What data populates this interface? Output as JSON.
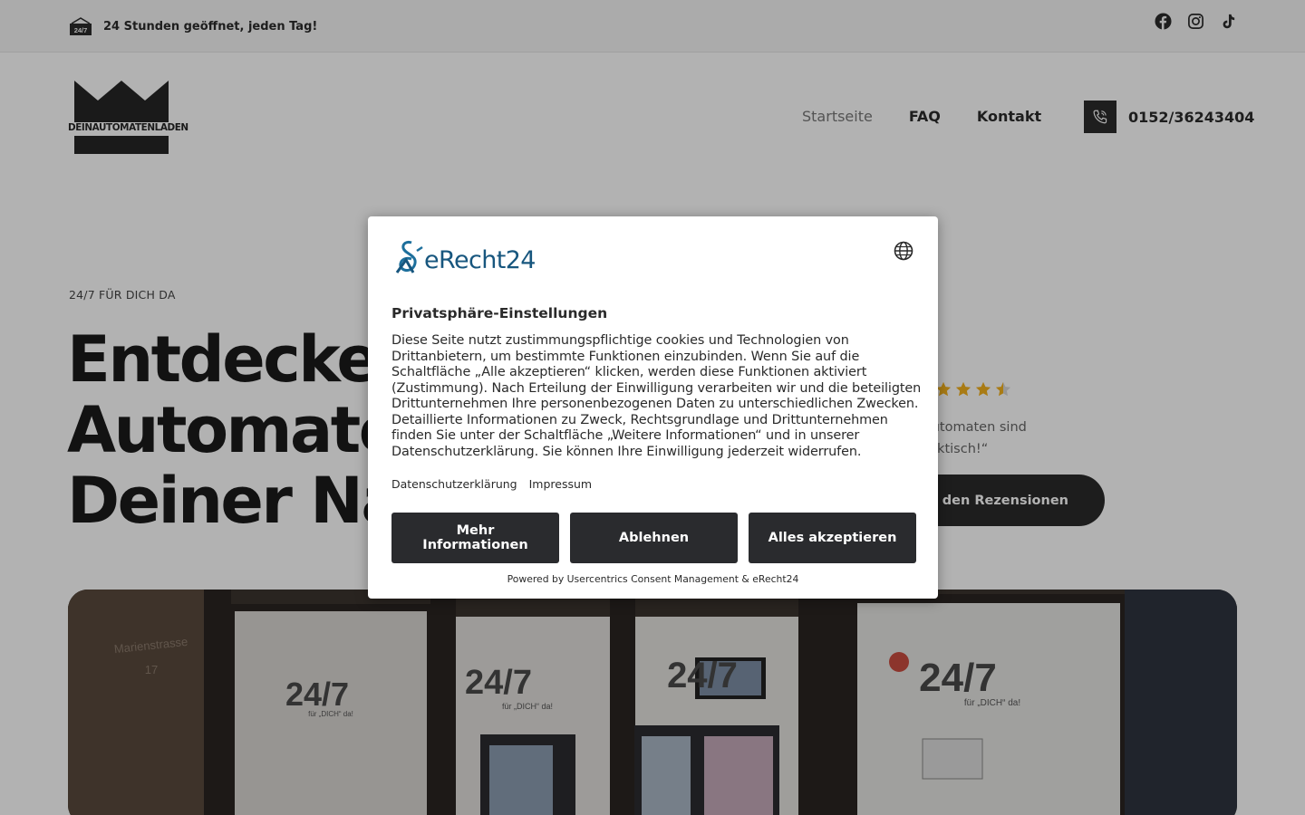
{
  "topbar": {
    "open_badge": "24/7",
    "open_text": "24 Stunden geöffnet, jeden Tag!",
    "socials": [
      "facebook-icon",
      "instagram-icon",
      "tiktok-icon"
    ]
  },
  "logo": {
    "text": "DEINAUTOMATENLADEN"
  },
  "nav": {
    "items": [
      {
        "label": "Startseite",
        "active": true
      },
      {
        "label": "FAQ",
        "active": false
      },
      {
        "label": "Kontakt",
        "active": false
      }
    ]
  },
  "phone": {
    "number": "0152/36243404"
  },
  "hero": {
    "eyebrow": "24/7 FÜR DICH DA",
    "headline_lines": [
      "Entdecke u",
      "Automate",
      "Deiner Näh"
    ],
    "rating_stars": 4.5,
    "quote_lines": [
      "„Automaten sind",
      "praktisch!“"
    ],
    "review_button": "Zu den Rezensionen"
  },
  "photo": {
    "signs": [
      "24/7",
      "24/7",
      "24/7",
      "24/7"
    ],
    "sign_sub": "für „DICH“ da!",
    "street": "Marienstrasse",
    "street_no": "17"
  },
  "consent": {
    "brand": "eRecht24",
    "title": "Privatsphäre-Einstellungen",
    "body_lines": [
      "Diese Seite nutzt zustimmungspflichtige cookies und Technologien von",
      "Drittanbietern, um bestimmte Funktionen einzubinden. Wenn Sie auf die",
      "Schaltfläche „Alle akzeptieren“ klicken, werden diese Funktionen aktiviert",
      "(Zustimmung). Nach Erteilung der Einwilligung verarbeiten wir und die beteiligten",
      "Drittunternehmen Ihre personenbezogenen Daten zu unterschiedlichen Zwecken.",
      "Detaillierte Informationen zu Zweck, Rechtsgrundlage und Drittunternehmen",
      "finden Sie unter der Schaltfläche „Weitere Informationen“ und in unserer",
      "Datenschutzerklärung. Sie können Ihre Einwilligung jederzeit widerrufen."
    ],
    "link_privacy": "Datenschutzerklärung",
    "link_imprint": "Impressum",
    "btn_more_line1": "Mehr",
    "btn_more_line2": "Informationen",
    "btn_decline": "Ablehnen",
    "btn_accept": "Alles akzeptieren",
    "powered": "Powered by Usercentrics Consent Management & eRecht24"
  },
  "colors": {
    "dark": "#2a2b2e",
    "brand_blue": "#17567e",
    "star": "#f2b01e",
    "overlay": "rgba(0,0,0,0.30)"
  }
}
